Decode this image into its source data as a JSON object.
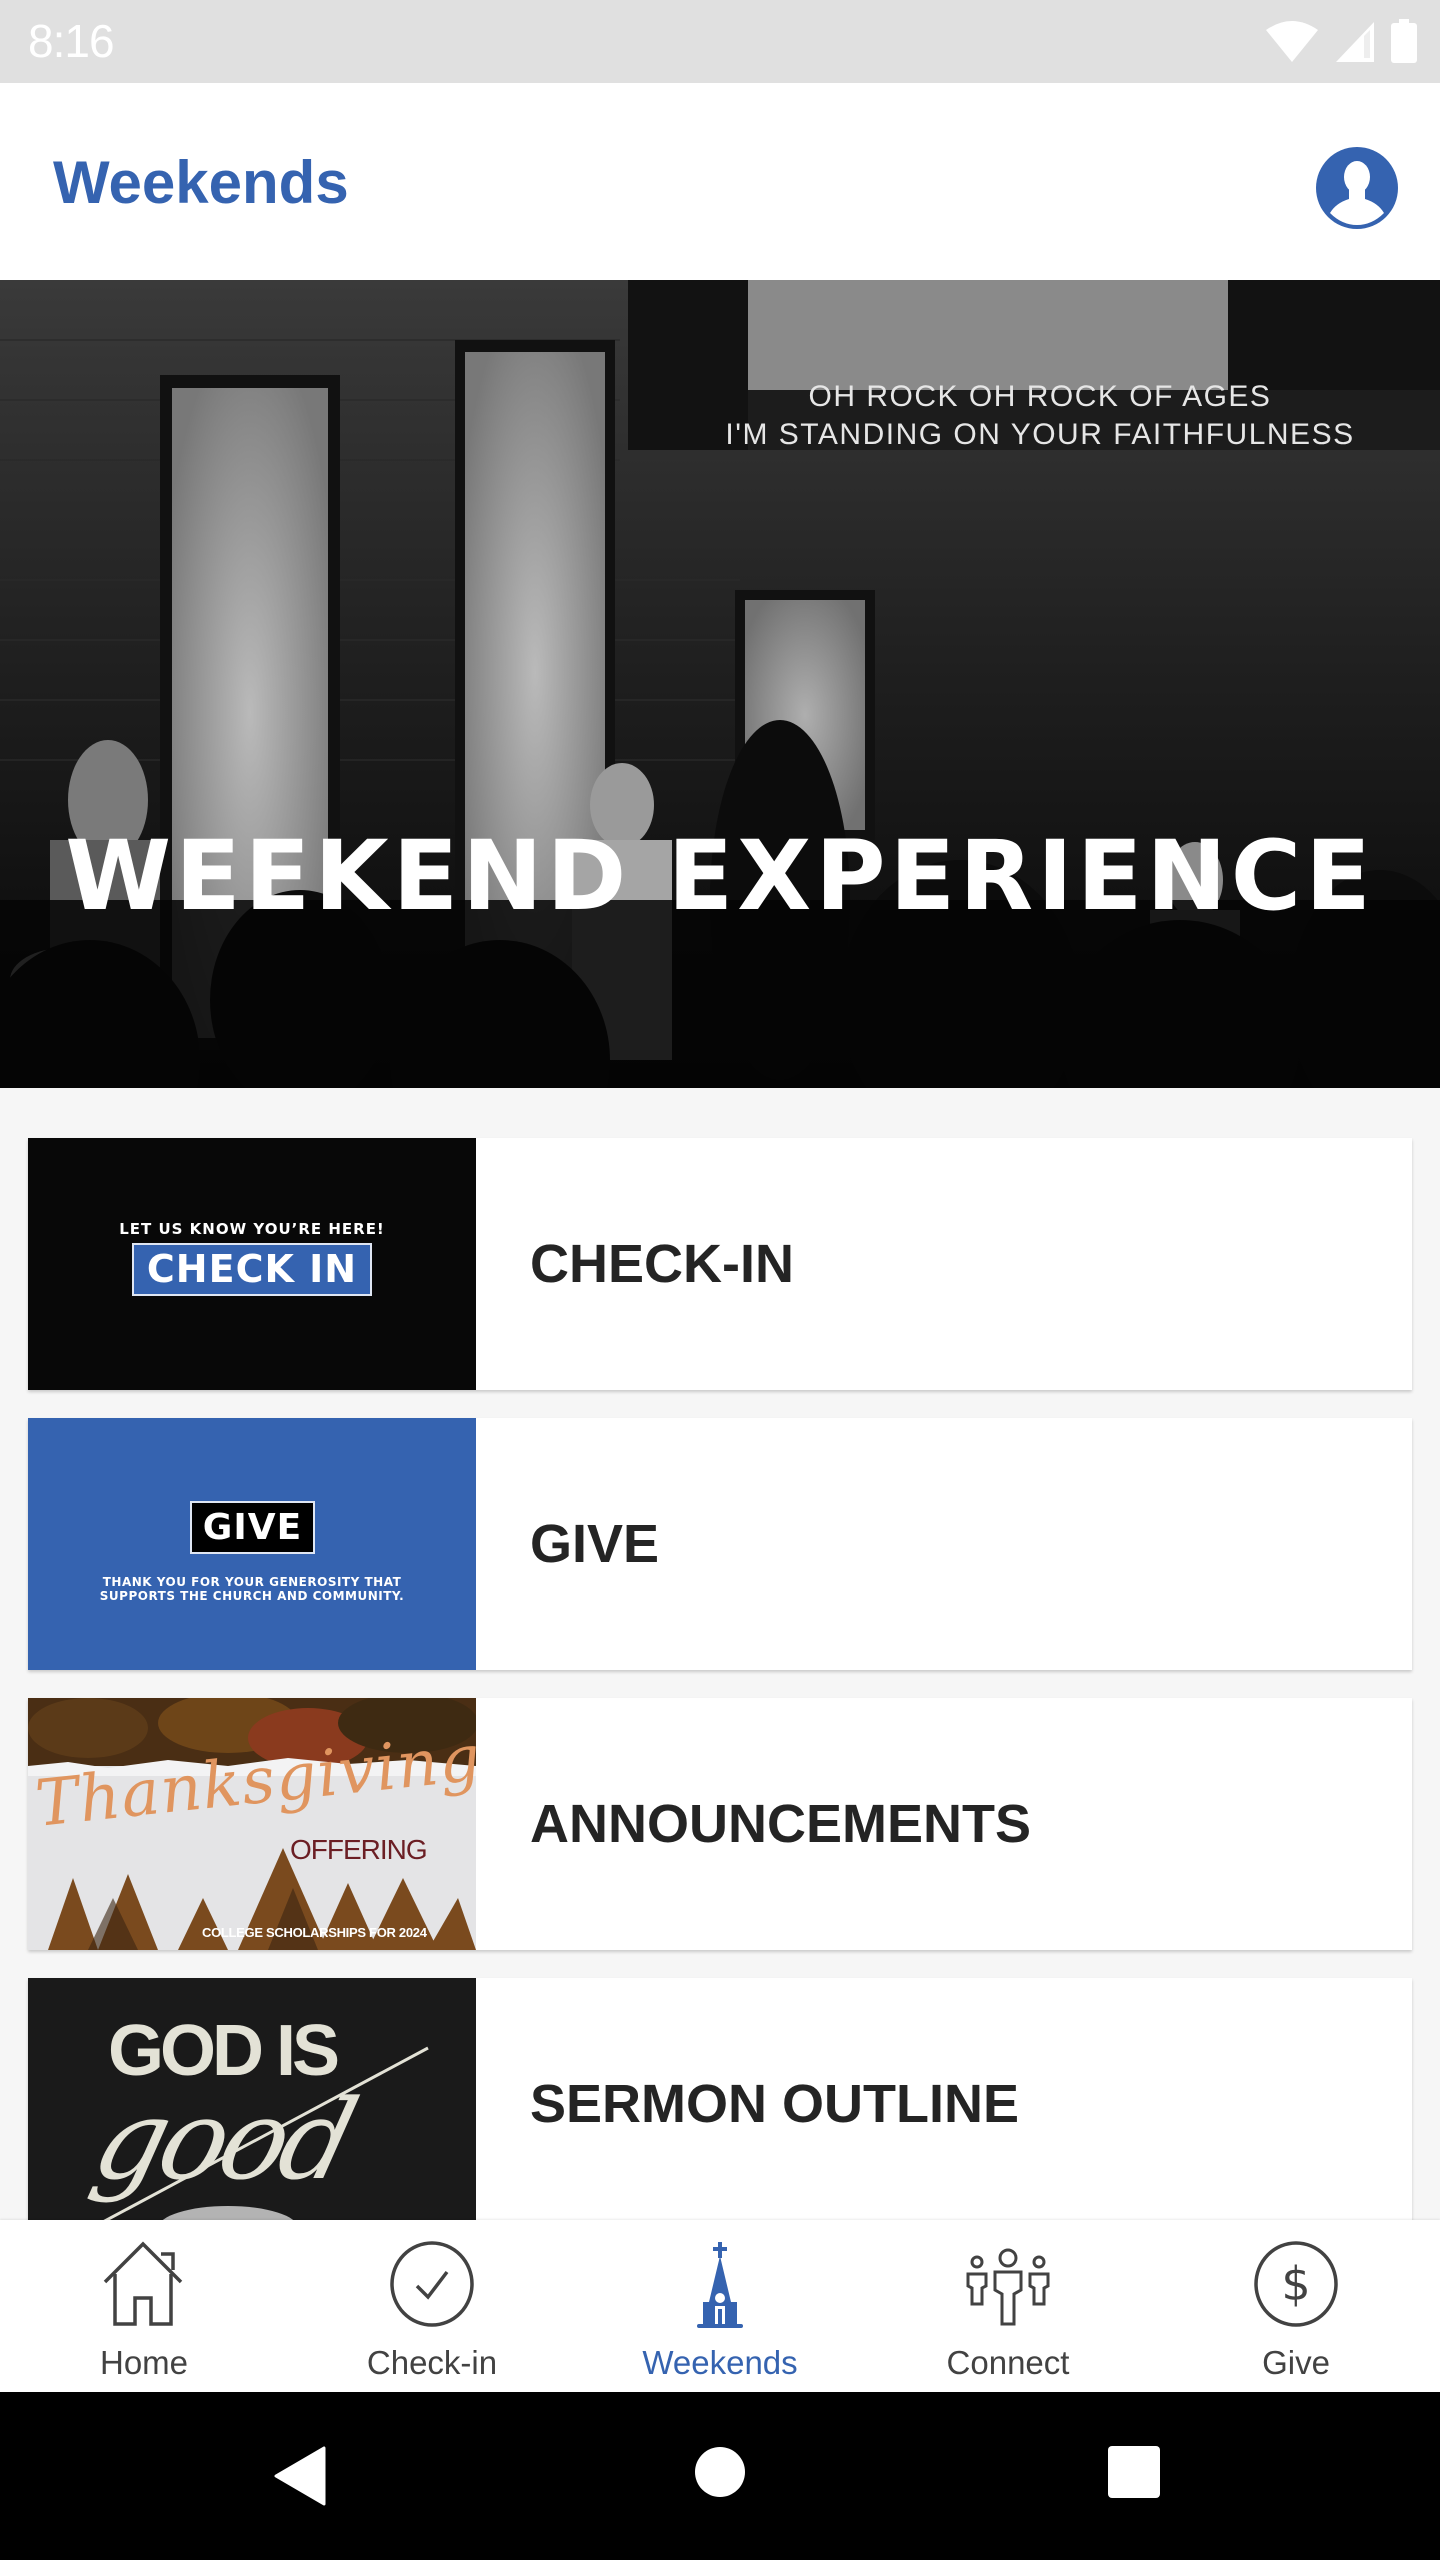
{
  "status_bar": {
    "time": "8:16",
    "icons": [
      "wifi-icon",
      "cell-signal-icon",
      "battery-icon"
    ]
  },
  "header": {
    "title": "Weekends",
    "profile_icon": "user-profile-icon"
  },
  "hero": {
    "title": "WEEKEND EXPERIENCE",
    "screen_lyrics": [
      "OH ROCK OH ROCK OF AGES",
      "I'M STANDING ON YOUR FAITHFULNESS"
    ]
  },
  "cards": [
    {
      "title": "CHECK-IN",
      "thumbnail": {
        "tagline": "LET US KNOW YOU’RE HERE!",
        "badge": "CHECK IN"
      }
    },
    {
      "title": "GIVE",
      "thumbnail": {
        "badge": "GIVE",
        "lines": [
          "THANK YOU FOR YOUR GENEROSITY THAT",
          "SUPPORTS THE CHURCH AND COMMUNITY."
        ]
      }
    },
    {
      "title": "ANNOUNCEMENTS",
      "thumbnail": {
        "script": "Thanksgiving",
        "subtitle": "OFFERING",
        "footer": "COLLEGE SCHOLARSHIPS FOR 2024"
      }
    },
    {
      "title": "SERMON OUTLINE",
      "thumbnail": {
        "line1": "GOD IS",
        "line2": "good"
      }
    }
  ],
  "bottom_nav": {
    "active": "Weekends",
    "items": [
      {
        "label": "Home",
        "icon": "home-icon"
      },
      {
        "label": "Check-in",
        "icon": "check-circle-icon"
      },
      {
        "label": "Weekends",
        "icon": "church-icon"
      },
      {
        "label": "Connect",
        "icon": "people-icon"
      },
      {
        "label": "Give",
        "icon": "dollar-circle-icon"
      }
    ]
  },
  "system_nav": {
    "buttons": [
      "back-icon",
      "home-circle-icon",
      "recents-icon"
    ]
  },
  "colors": {
    "accent": "#3563b0",
    "status_bar": "#e0e0e0",
    "page_background": "#f6f6f6",
    "card_title": "#242424",
    "nav_inactive": "#424242"
  }
}
